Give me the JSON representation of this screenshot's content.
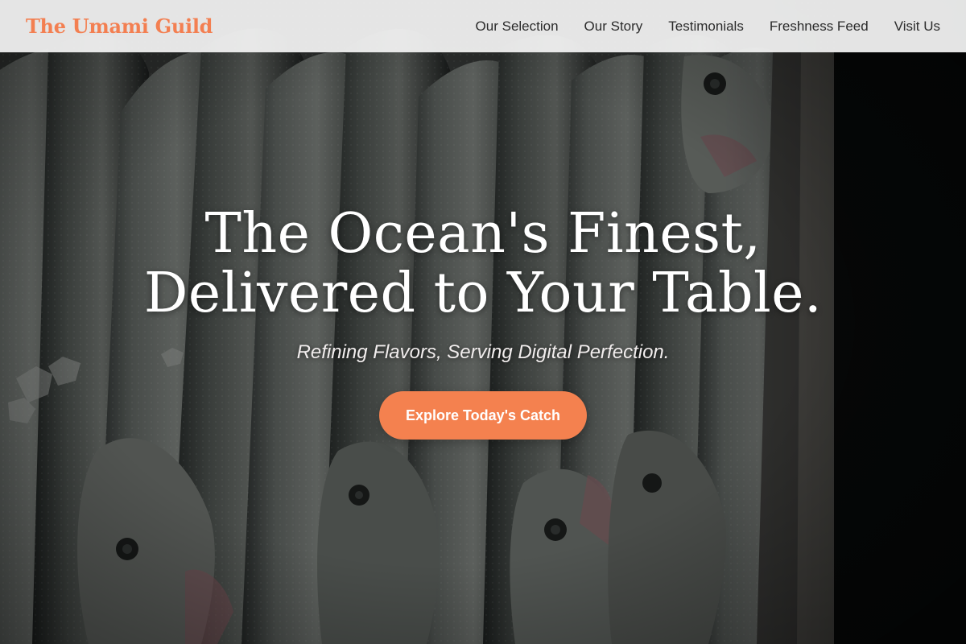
{
  "header": {
    "brand": "The Umami Guild",
    "nav": [
      {
        "label": "Our Selection"
      },
      {
        "label": "Our Story"
      },
      {
        "label": "Testimonials"
      },
      {
        "label": "Freshness Feed"
      },
      {
        "label": "Visit Us"
      }
    ]
  },
  "hero": {
    "title_line1": "The Ocean's Finest,",
    "title_line2": "Delivered to Your Table.",
    "subtitle": "Refining Flavors, Serving Digital Perfection.",
    "cta_label": "Explore Today's Catch"
  },
  "colors": {
    "brand": "#f37f51",
    "cta": "#f4814f",
    "nav_bg": "#f4f4f4",
    "hero_text": "#ffffff"
  }
}
